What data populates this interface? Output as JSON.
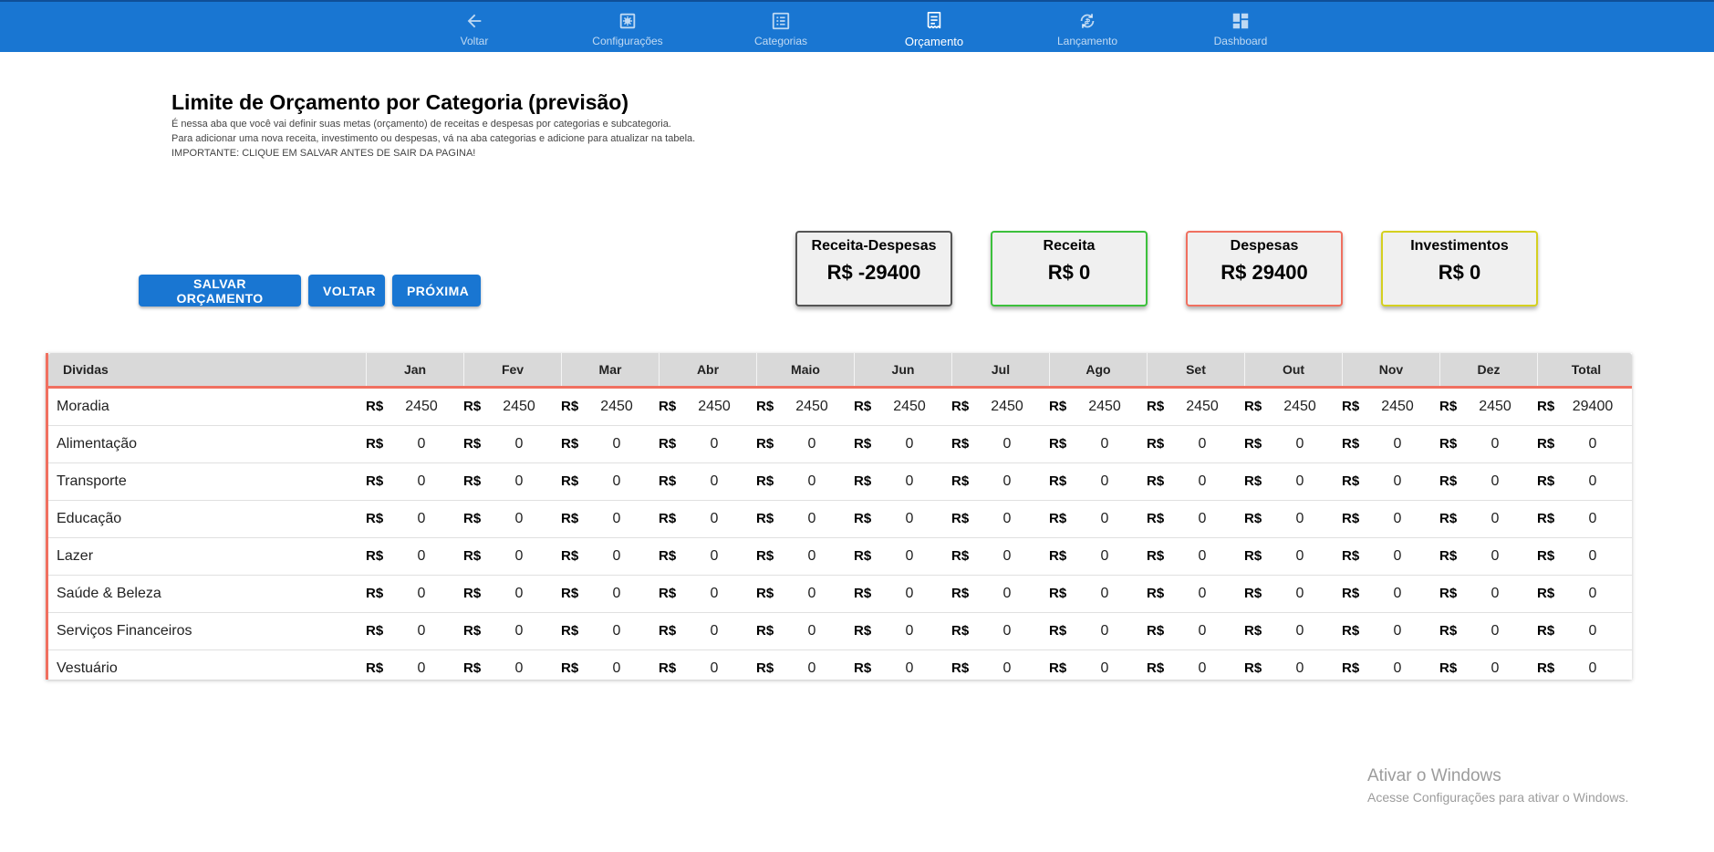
{
  "nav": {
    "items": [
      {
        "label": "Voltar",
        "icon": "arrow-left-icon"
      },
      {
        "label": "Configurações",
        "icon": "settings-icon"
      },
      {
        "label": "Categorias",
        "icon": "list-icon"
      },
      {
        "label": "Orçamento",
        "icon": "receipt-icon"
      },
      {
        "label": "Lançamento",
        "icon": "sync-icon"
      },
      {
        "label": "Dashboard",
        "icon": "dashboard-icon"
      }
    ],
    "active": "Orçamento"
  },
  "page": {
    "title": "Limite de Orçamento por Categoria (previsão)",
    "desc1": "É nessa aba que você vai definir suas metas (orçamento) de receitas e despesas por categorias e subcategoria.",
    "desc2": "Para adicionar uma nova receita, investimento ou despesas, vá na aba categorias e adicione para atualizar na tabela.",
    "desc3": "IMPORTANTE: CLIQUE EM SALVAR ANTES DE SAIR DA PAGINA!"
  },
  "actions": {
    "save": "SALVAR ORÇAMENTO",
    "back": "VOLTAR",
    "next": "PRÓXIMA"
  },
  "summary": [
    {
      "title": "Receita-Despesas",
      "value": "R$ -29400",
      "border": "#555555"
    },
    {
      "title": "Receita",
      "value": "R$ 0",
      "border": "#3cc03c"
    },
    {
      "title": "Despesas",
      "value": "R$ 29400",
      "border": "#f07060"
    },
    {
      "title": "Investimentos",
      "value": "R$ 0",
      "border": "#d4d020"
    }
  ],
  "table": {
    "section": "Dividas",
    "accent": "#f07060",
    "currency": "R$",
    "columns": [
      "Jan",
      "Fev",
      "Mar",
      "Abr",
      "Maio",
      "Jun",
      "Jul",
      "Ago",
      "Set",
      "Out",
      "Nov",
      "Dez",
      "Total"
    ],
    "rows": [
      {
        "name": "Moradia",
        "values": [
          "2450",
          "2450",
          "2450",
          "2450",
          "2450",
          "2450",
          "2450",
          "2450",
          "2450",
          "2450",
          "2450",
          "2450",
          "29400"
        ]
      },
      {
        "name": "Alimentação",
        "values": [
          "0",
          "0",
          "0",
          "0",
          "0",
          "0",
          "0",
          "0",
          "0",
          "0",
          "0",
          "0",
          "0"
        ]
      },
      {
        "name": "Transporte",
        "values": [
          "0",
          "0",
          "0",
          "0",
          "0",
          "0",
          "0",
          "0",
          "0",
          "0",
          "0",
          "0",
          "0"
        ]
      },
      {
        "name": "Educação",
        "values": [
          "0",
          "0",
          "0",
          "0",
          "0",
          "0",
          "0",
          "0",
          "0",
          "0",
          "0",
          "0",
          "0"
        ]
      },
      {
        "name": "Lazer",
        "values": [
          "0",
          "0",
          "0",
          "0",
          "0",
          "0",
          "0",
          "0",
          "0",
          "0",
          "0",
          "0",
          "0"
        ]
      },
      {
        "name": "Saúde & Beleza",
        "values": [
          "0",
          "0",
          "0",
          "0",
          "0",
          "0",
          "0",
          "0",
          "0",
          "0",
          "0",
          "0",
          "0"
        ]
      },
      {
        "name": "Serviços Financeiros",
        "values": [
          "0",
          "0",
          "0",
          "0",
          "0",
          "0",
          "0",
          "0",
          "0",
          "0",
          "0",
          "0",
          "0"
        ]
      },
      {
        "name": "Vestuário",
        "values": [
          "0",
          "0",
          "0",
          "0",
          "0",
          "0",
          "0",
          "0",
          "0",
          "0",
          "0",
          "0",
          "0"
        ]
      }
    ]
  },
  "watermark": {
    "title": "Ativar o Windows",
    "subtitle": "Acesse Configurações para ativar o Windows."
  }
}
